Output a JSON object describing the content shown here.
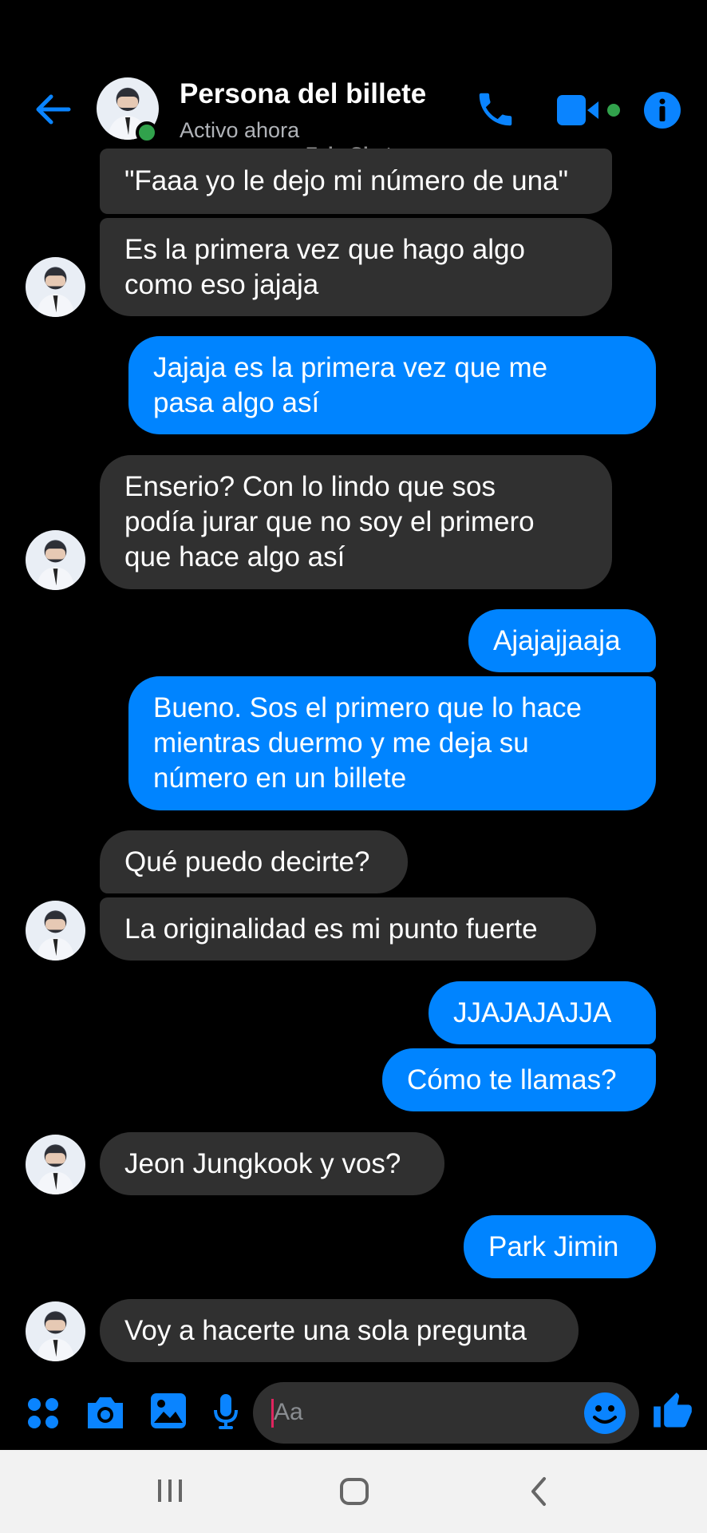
{
  "header": {
    "contact_name": "Persona del billete",
    "status": "Activo ahora",
    "watermark": "FakeChat",
    "icons": [
      "back-arrow-icon",
      "phone-icon",
      "video-camera-icon",
      "info-icon"
    ]
  },
  "messages": [
    {
      "from": "them",
      "text": "\"Faaa yo le dejo mi número de una\""
    },
    {
      "from": "them",
      "text": "Es la primera vez que hago algo\ncomo eso jajaja"
    },
    {
      "from": "me",
      "text": "Jajaja es la primera vez que me\npasa algo así"
    },
    {
      "from": "them",
      "text": "Enserio? Con lo lindo que sos\npodía jurar que no soy el primero\nque hace algo así"
    },
    {
      "from": "me",
      "text": "Ajajajjaaja"
    },
    {
      "from": "me",
      "text": "Bueno.  Sos el primero que lo hace\nmientras duermo y me deja su\nnúmero en un billete"
    },
    {
      "from": "them",
      "text": "Qué puedo decirte?"
    },
    {
      "from": "them",
      "text": "La originalidad es mi punto fuerte"
    },
    {
      "from": "me",
      "text": "JJAJAJAJJA"
    },
    {
      "from": "me",
      "text": "Cómo te llamas?"
    },
    {
      "from": "them",
      "text": "Jeon Jungkook y vos?"
    },
    {
      "from": "me",
      "text": "Park Jimin"
    },
    {
      "from": "them",
      "text": "Voy a hacerte una sola pregunta"
    }
  ],
  "composer": {
    "placeholder": "Aa",
    "icons": [
      "apps-grid-icon",
      "camera-icon",
      "gallery-icon",
      "microphone-icon",
      "emoji-icon",
      "thumbs-up-icon"
    ]
  },
  "navbar": {
    "icons": [
      "recent-apps-icon",
      "home-icon",
      "back-nav-icon"
    ]
  },
  "colors": {
    "accent": "#0084ff",
    "incoming_bubble": "#303030",
    "online": "#31a24c",
    "background": "#000000"
  }
}
